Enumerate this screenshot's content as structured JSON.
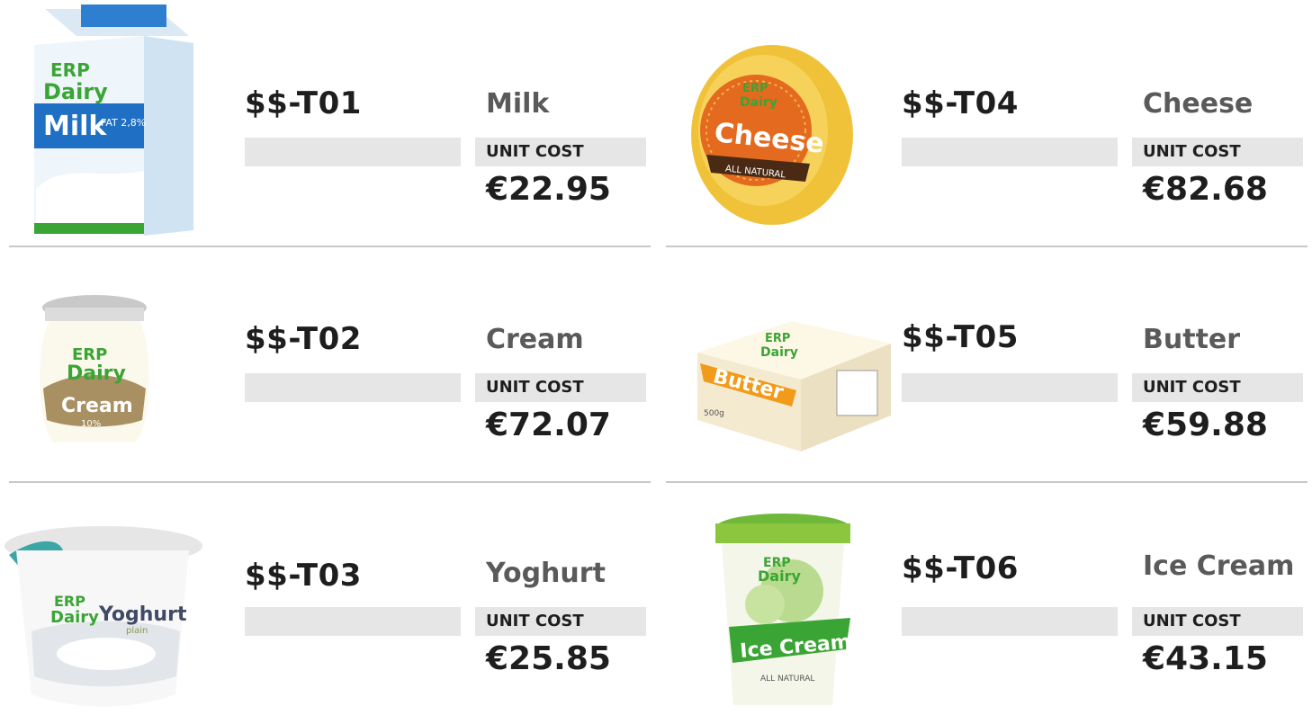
{
  "cost_label": "UNIT COST",
  "colors": {
    "text": "#1e1e1e",
    "name_text": "#5a5a5a",
    "bar": "#e6e6e6",
    "divider": "#c8c8c8",
    "brand_green": "#3aa534"
  },
  "products": [
    {
      "sku": "$$-T01",
      "name": "Milk",
      "price": "€22.95",
      "image": "milk-carton-image",
      "pack_label": "Milk",
      "pack_sub": "FAT 2,8%"
    },
    {
      "sku": "$$-T02",
      "name": "Cream",
      "price": "€72.07",
      "image": "cream-jar-image",
      "pack_label": "Cream",
      "pack_sub": "10%"
    },
    {
      "sku": "$$-T03",
      "name": "Yoghurt",
      "price": "€25.85",
      "image": "yoghurt-cup-image",
      "pack_label": "Yoghurt",
      "pack_sub": "plain"
    },
    {
      "sku": "$$-T04",
      "name": "Cheese",
      "price": "€82.68",
      "image": "cheese-wheel-image",
      "pack_label": "Cheese",
      "pack_sub": "ALL NATURAL"
    },
    {
      "sku": "$$-T05",
      "name": "Butter",
      "price": "€59.88",
      "image": "butter-box-image",
      "pack_label": "Butter",
      "pack_sub": "500g"
    },
    {
      "sku": "$$-T06",
      "name": "Ice Cream",
      "price": "€43.15",
      "image": "ice-cream-tub-image",
      "pack_label": "Ice Cream",
      "pack_sub": "ALL NATURAL"
    }
  ],
  "brand": {
    "line1": "ERP",
    "line2": "Dairy"
  }
}
